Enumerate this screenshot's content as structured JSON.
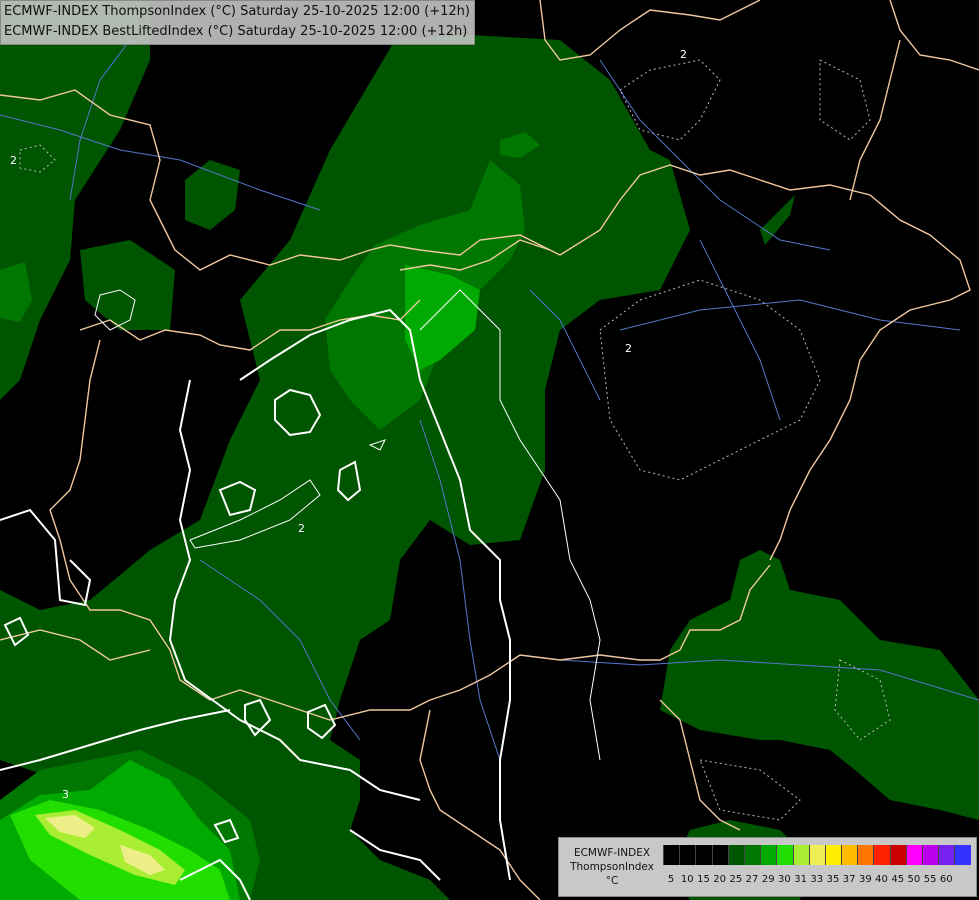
{
  "header": {
    "line1": "ECMWF-INDEX ThompsonIndex (°C) Saturday 25-10-2025 12:00 (+12h)",
    "line2": "ECMWF-INDEX BestLiftedIndex (°C) Saturday 25-10-2025 12:00 (+12h)"
  },
  "legend": {
    "title": "ECMWF-INDEX",
    "subtitle": "ThompsonIndex",
    "unit": "°C",
    "ticks": [
      "5",
      "10",
      "15",
      "20",
      "25",
      "27",
      "29",
      "30",
      "31",
      "33",
      "35",
      "37",
      "39",
      "40",
      "45",
      "50",
      "55",
      "60"
    ],
    "colors": [
      "#000000",
      "#000000",
      "#000000",
      "#000000",
      "#005500",
      "#007700",
      "#00aa00",
      "#22dd00",
      "#aaee33",
      "#eeee55",
      "#ffee00",
      "#ffbb00",
      "#ff7700",
      "#ff2200",
      "#cc0000",
      "#ff00ff",
      "#bb00ee",
      "#7722ee",
      "#3333ff"
    ]
  },
  "contour_labels": {
    "l1": "2",
    "l2": "2",
    "l3": "2",
    "l4": "2",
    "l5": "3"
  },
  "colors": {
    "background": "#000000",
    "field_dark_green": "#005500",
    "field_green": "#007700",
    "field_bright_green": "#00aa00",
    "field_light_green": "#22dd00",
    "field_yellow_green": "#aaee33",
    "field_pale_yellow": "#eeee88",
    "border_lines": "#f0c8a0",
    "rivers": "#5577cc",
    "contours": "#ffffff"
  }
}
